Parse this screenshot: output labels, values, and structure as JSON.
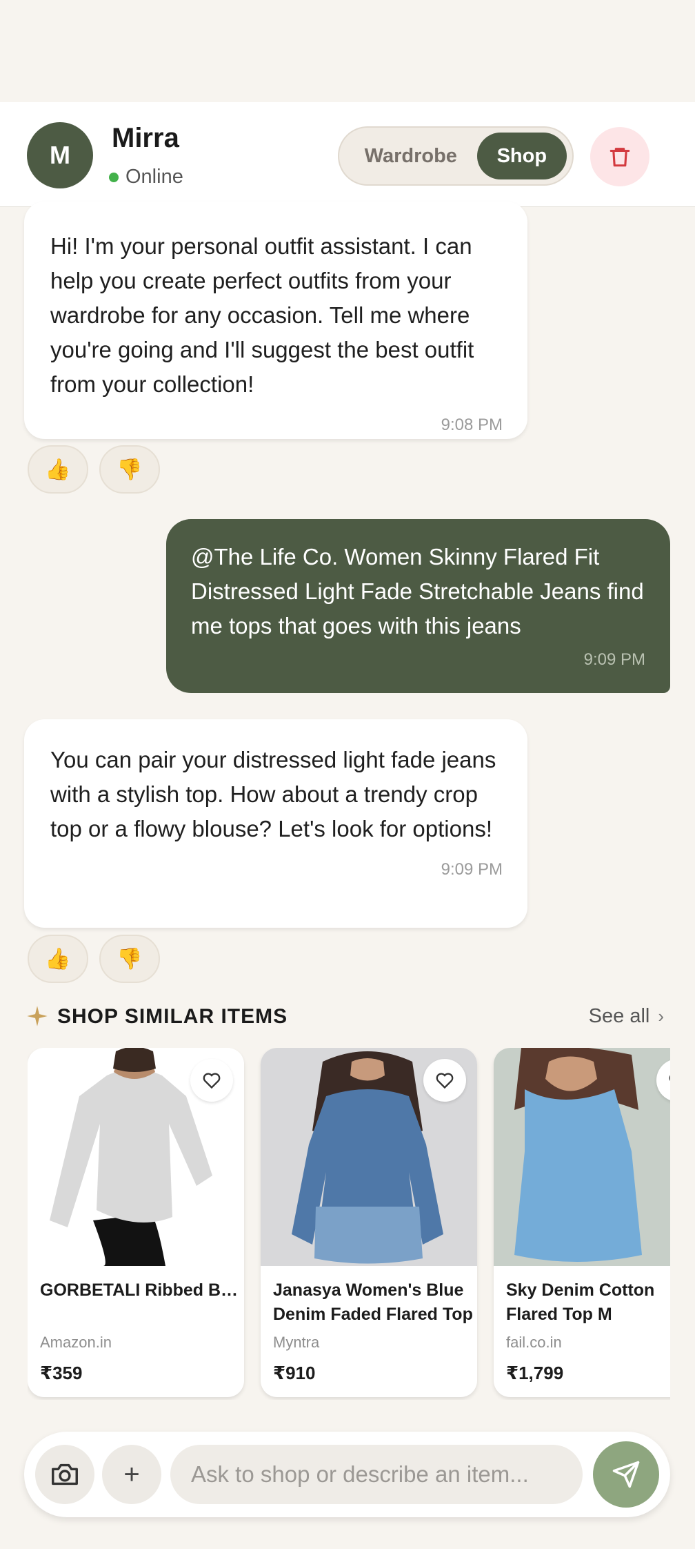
{
  "header": {
    "avatar_initial": "M",
    "contact_name": "Mirra",
    "status": "Online",
    "tabs": [
      {
        "label": "Wardrobe",
        "selected": false
      },
      {
        "label": "Shop",
        "selected": true
      }
    ],
    "delete_icon": "trash-icon"
  },
  "messages": [
    {
      "sender": "assistant",
      "text": "Hi! I'm your personal outfit assistant. I can help you create perfect outfits from your wardrobe for any occasion. Tell me where you're going and I'll suggest the best outfit from your collection!",
      "time": "9:08 PM"
    },
    {
      "sender": "user",
      "text": "@The Life Co. Women Skinny Flared Fit Distressed Light Fade Stretchable Jeans find me tops that goes with this jeans",
      "time": "9:09 PM"
    },
    {
      "sender": "assistant",
      "text": "You can pair your distressed light fade jeans with a stylish top. How about a trendy crop top or a flowy blouse? Let's look for options!",
      "time": "9:09 PM"
    }
  ],
  "reactions": {
    "like": "👍",
    "dislike": "👎"
  },
  "shop": {
    "section_title": "SHOP SIMILAR ITEMS",
    "see_all": "See all",
    "products": [
      {
        "name": "GORBETALI Ribbed Bell Sleeve Round Neck Asymmetric Hem Top",
        "source": "Amazon.in",
        "price": "₹359"
      },
      {
        "name": "Janasya Women's Blue Denim Faded Flared Top",
        "source": "Myntra",
        "price": "₹910"
      },
      {
        "name": "Sky Denim Cotton Flared Top M",
        "source": "fail.co.in",
        "price": "₹1,799"
      }
    ]
  },
  "composer": {
    "placeholder": "Ask to shop or describe an item...",
    "value": ""
  },
  "colors": {
    "accent": "#4d5b44",
    "background": "#f7f4ef",
    "send": "#8ea67f",
    "online": "#43b14b",
    "danger_bg": "#fde5e7",
    "danger": "#d33a3f"
  }
}
